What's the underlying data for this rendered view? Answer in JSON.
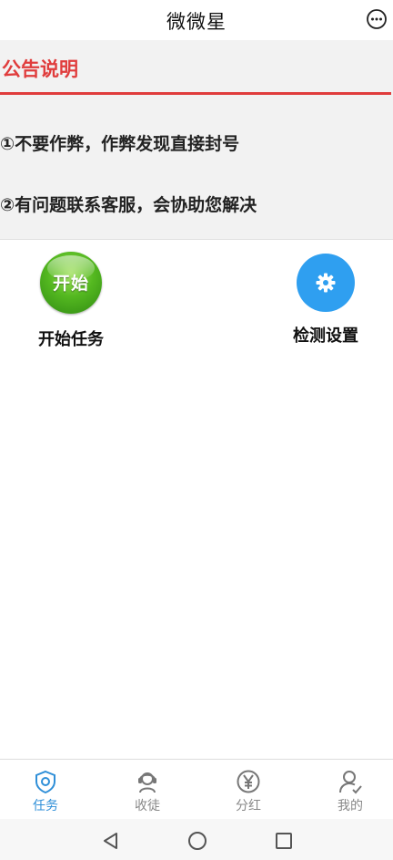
{
  "header": {
    "title": "微微星",
    "more_icon": "chat-dots-icon"
  },
  "notice": {
    "title": "公告说明",
    "items": [
      "①不要作弊，作弊发现直接封号",
      "②有问题联系客服，会协助您解决"
    ],
    "accent": "#e03c3c"
  },
  "actions": {
    "start": {
      "icon_text": "开始",
      "label": "开始任务"
    },
    "settings": {
      "icon": "gear-icon",
      "label": "检测设置"
    }
  },
  "tabbar": {
    "tabs": [
      {
        "label": "任务",
        "icon": "shield-icon",
        "active": true
      },
      {
        "label": "收徒",
        "icon": "user-headset-icon",
        "active": false
      },
      {
        "label": "分红",
        "icon": "yen-circle-icon",
        "active": false
      },
      {
        "label": "我的",
        "icon": "user-check-icon",
        "active": false
      }
    ],
    "active_color": "#2f8fd8",
    "inactive_color": "#888888"
  },
  "system_nav": {
    "buttons": [
      "back-icon",
      "home-icon",
      "recents-icon"
    ]
  }
}
